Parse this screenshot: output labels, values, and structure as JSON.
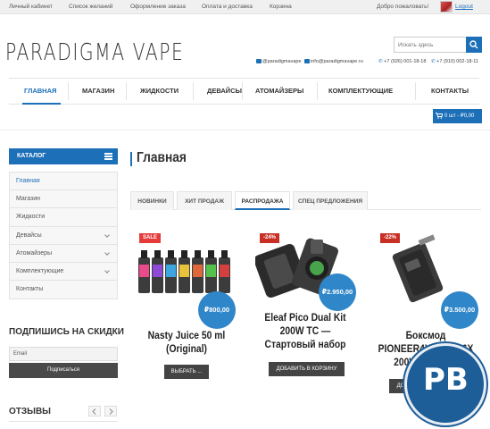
{
  "topbar": {
    "links": [
      "Личный кабинет",
      "Список желаний",
      "Оформление заказа",
      "Оплата и доставка",
      "Корзина"
    ],
    "welcome": "Добро пожаловать!",
    "logout": "Logout"
  },
  "header": {
    "logo": "PARADIGMA VAPE",
    "search_placeholder": "Искать здесь",
    "instagram": "@paradigmavape",
    "email": "info@paradigmavape.ru",
    "phone1": "+7 (926) 001-18-18",
    "phone2": "+7 (910) 002-18-11"
  },
  "nav": {
    "items": [
      "ГЛАВНАЯ",
      "МАГАЗИН",
      "ЖИДКОСТИ",
      "ДЕВАЙСЫ",
      "АТОМАЙЗЕРЫ",
      "КОМПЛЕКТУЮЩИЕ",
      "КОНТАКТЫ"
    ],
    "active_index": 0,
    "cart": "0 шт - ₽0,00"
  },
  "sidebar": {
    "catalog_title": "КАТАЛОГ",
    "categories": [
      {
        "label": "Главная",
        "active": true,
        "expandable": false
      },
      {
        "label": "Магазин",
        "active": false,
        "expandable": false
      },
      {
        "label": "Жидкости",
        "active": false,
        "expandable": false
      },
      {
        "label": "Девайсы",
        "active": false,
        "expandable": true
      },
      {
        "label": "Атомайзеры",
        "active": false,
        "expandable": true
      },
      {
        "label": "Комплектующие",
        "active": false,
        "expandable": true
      },
      {
        "label": "Контакты",
        "active": false,
        "expandable": false
      }
    ],
    "subscribe_title": "ПОДПИШИСЬ НА СКИДКИ",
    "email_value": "Email",
    "subscribe_button": "Подписаться",
    "reviews_title": "ОТЗЫВЫ"
  },
  "main": {
    "title": "Главная",
    "tabs": [
      "НОВИНКИ",
      "ХИТ ПРОДАЖ",
      "РАСПРОДАЖА",
      "СПЕЦ ПРЕДЛОЖЕНИЯ"
    ],
    "active_tab": 2,
    "products": [
      {
        "badge": "SALE",
        "price": "₽800,00",
        "name_line1": "Nasty Juice 50 ml",
        "name_line2": "(Original)",
        "name_line3": "",
        "button": "ВЫБРАТЬ ..."
      },
      {
        "badge": "-24%",
        "price": "₽2.950,00",
        "name_line1": "Eleaf Pico Dual Kit",
        "name_line2": "200W TC —",
        "name_line3": "Стартовый набор",
        "button": "ДОБАВИТЬ В КОРЗИНУ"
      },
      {
        "badge": "-22%",
        "price": "₽3.500,00",
        "name_line1": "Боксмод",
        "name_line2": "PIONEER4YOU IPV6X",
        "name_line3": "200W Upgrade",
        "button": "ДОБАВИТЬ В КОРЗИНУ"
      }
    ]
  },
  "watermark": "PB",
  "colors": {
    "accent": "#1d6fb8",
    "badge_red": "#e53b3b",
    "price_circle": "#2f86c9",
    "button_dark": "#444444"
  }
}
